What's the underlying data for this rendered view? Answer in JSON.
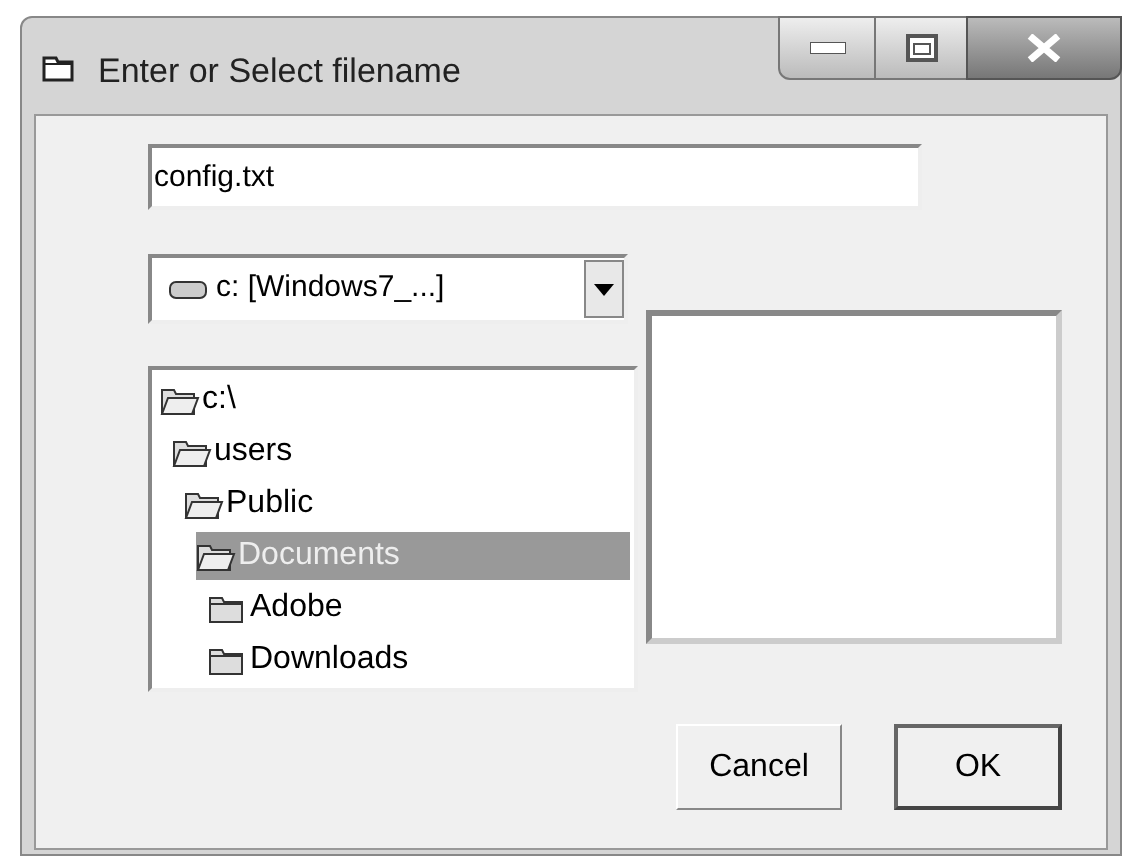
{
  "window": {
    "title": "Enter or Select filename"
  },
  "filename_field": {
    "value": "config.txt"
  },
  "drive_combo": {
    "value": "c: [Windows7_...]"
  },
  "folder_tree": [
    {
      "label": "c:\\",
      "expanded": true,
      "selected": false,
      "children": [
        {
          "label": "users",
          "expanded": true,
          "selected": false,
          "children": [
            {
              "label": "Public",
              "expanded": true,
              "selected": false,
              "children": [
                {
                  "label": "Documents",
                  "expanded": true,
                  "selected": true,
                  "children": [
                    {
                      "label": "Adobe",
                      "expanded": false,
                      "selected": false
                    },
                    {
                      "label": "Downloads",
                      "expanded": false,
                      "selected": false
                    }
                  ]
                }
              ]
            }
          ]
        }
      ]
    }
  ],
  "buttons": [
    {
      "label": "Cancel",
      "default": false
    },
    {
      "label": "OK",
      "default": true
    }
  ]
}
